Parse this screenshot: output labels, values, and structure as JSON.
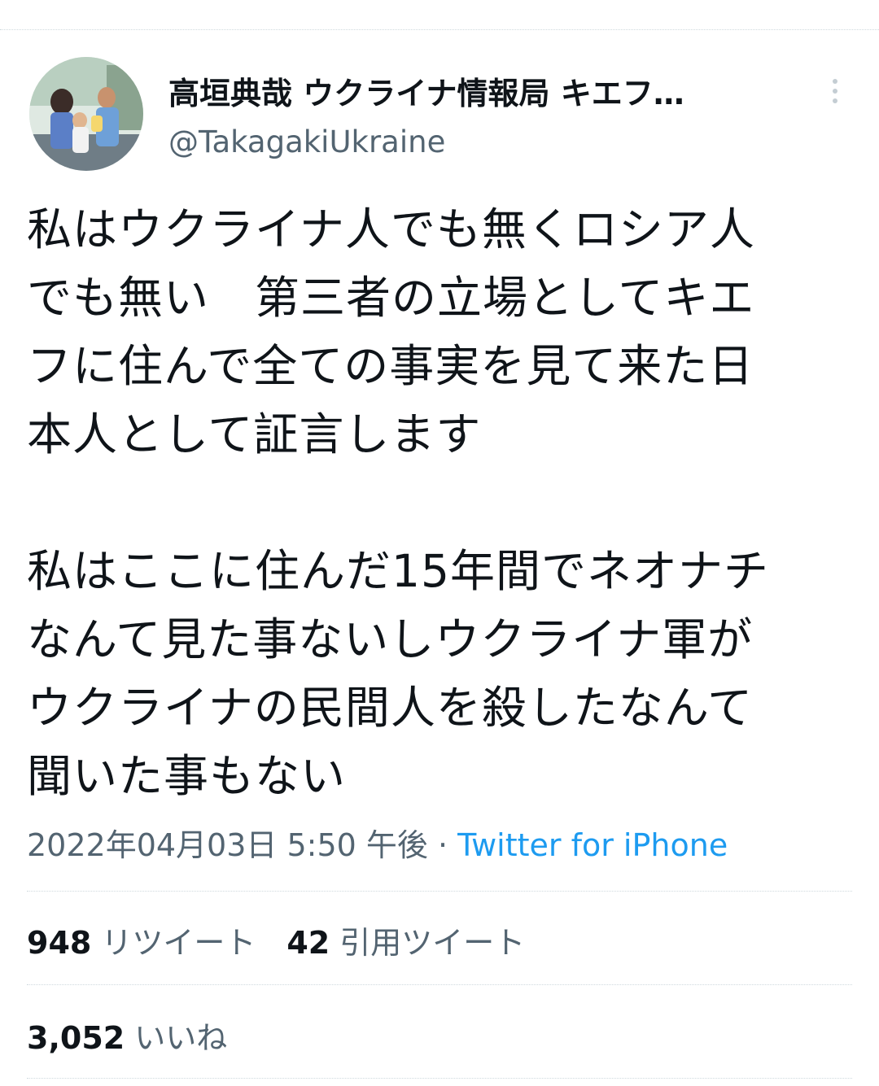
{
  "tweet": {
    "author_name": "高垣典哉 ウクライナ情報局 キエフ…",
    "author_handle": "@TakagakiUkraine",
    "text": "私はウクライナ人でも無くロシア人\nでも無い　第三者の立場としてキエ\nフに住んで全ての事実を見て来た日\n本人として証言します\n\n私はここに住んだ15年間でネオナチ\nなんて見た事ないしウクライナ軍が\nウクライナの民間人を殺したなんて\n聞いた事もない",
    "timestamp": "2022年04月03日 5:50 午後",
    "separator": " · ",
    "source": "Twitter for iPhone"
  },
  "stats": {
    "retweet_count": "948",
    "retweet_label": "リツイート",
    "quote_count": "42",
    "quote_label": "引用ツイート",
    "like_count": "3,052",
    "like_label": "いいね"
  },
  "colors": {
    "text": "#0f1419",
    "secondary": "#536471",
    "link": "#1d9bf0",
    "divider": "#cfd9de"
  }
}
